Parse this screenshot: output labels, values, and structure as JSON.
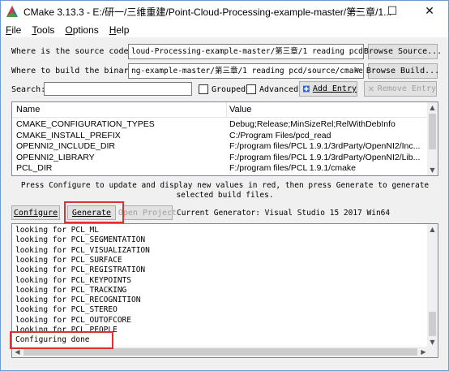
{
  "window": {
    "title": "CMake 3.13.3 - E:/研一/三维重建/Point-Cloud-Processing-example-master/第三章/1...",
    "minimize_glyph": "—",
    "maximize_glyph": "☐",
    "close_glyph": "✕"
  },
  "menu": [
    {
      "key": "F",
      "rest": "ile"
    },
    {
      "key": "T",
      "rest": "ools"
    },
    {
      "key": "O",
      "rest": "ptions"
    },
    {
      "key": "H",
      "rest": "elp"
    }
  ],
  "source": {
    "label": "Where is the source code:",
    "value": "loud-Processing-example-master/第三章/1 reading pcd/source",
    "browse_label": "Browse Source..."
  },
  "build": {
    "label": "Where to build the binaries:",
    "value": "ng-example-master/第三章/1 reading pcd/source/cmake_bin",
    "browse_label": "Browse Build..."
  },
  "search": {
    "label": "Search:",
    "value": "",
    "grouped_label": "Grouped",
    "advanced_label": "Advanced",
    "add_entry_label": "Add Entry",
    "remove_entry_label": "Remove Entry"
  },
  "table": {
    "col_name": "Name",
    "col_value": "Value",
    "rows": [
      {
        "name": "CMAKE_CONFIGURATION_TYPES",
        "value": "Debug;Release;MinSizeRel;RelWithDebInfo"
      },
      {
        "name": "CMAKE_INSTALL_PREFIX",
        "value": "C:/Program Files/pcd_read"
      },
      {
        "name": "OPENNI2_INCLUDE_DIR",
        "value": "F:/program files/PCL 1.9.1/3rdParty/OpenNI2/Inc..."
      },
      {
        "name": "OPENNI2_LIBRARY",
        "value": "F:/program files/PCL 1.9.1/3rdParty/OpenNI2/Lib..."
      },
      {
        "name": "PCL_DIR",
        "value": "F:/program files/PCL 1.9.1/cmake"
      }
    ]
  },
  "note": "Press Configure to update and display new values in red, then press Generate to generate selected build files.",
  "actions": {
    "configure_label": "Configure",
    "generate_label": "Generate",
    "open_project_label": "Open Project",
    "current_generator": "Current Generator: Visual Studio 15 2017 Win64"
  },
  "output": [
    "looking for PCL_ML",
    "looking for PCL_SEGMENTATION",
    "looking for PCL_VISUALIZATION",
    "looking for PCL_SURFACE",
    "looking for PCL_REGISTRATION",
    "looking for PCL_KEYPOINTS",
    "looking for PCL_TRACKING",
    "looking for PCL_RECOGNITION",
    "looking for PCL_STEREO",
    "looking for PCL_OUTOFCORE",
    "looking for PCL_PEOPLE",
    "Configuring done"
  ],
  "colors": {
    "highlight_box": "#e03030",
    "window_border": "#6b9bd1"
  }
}
